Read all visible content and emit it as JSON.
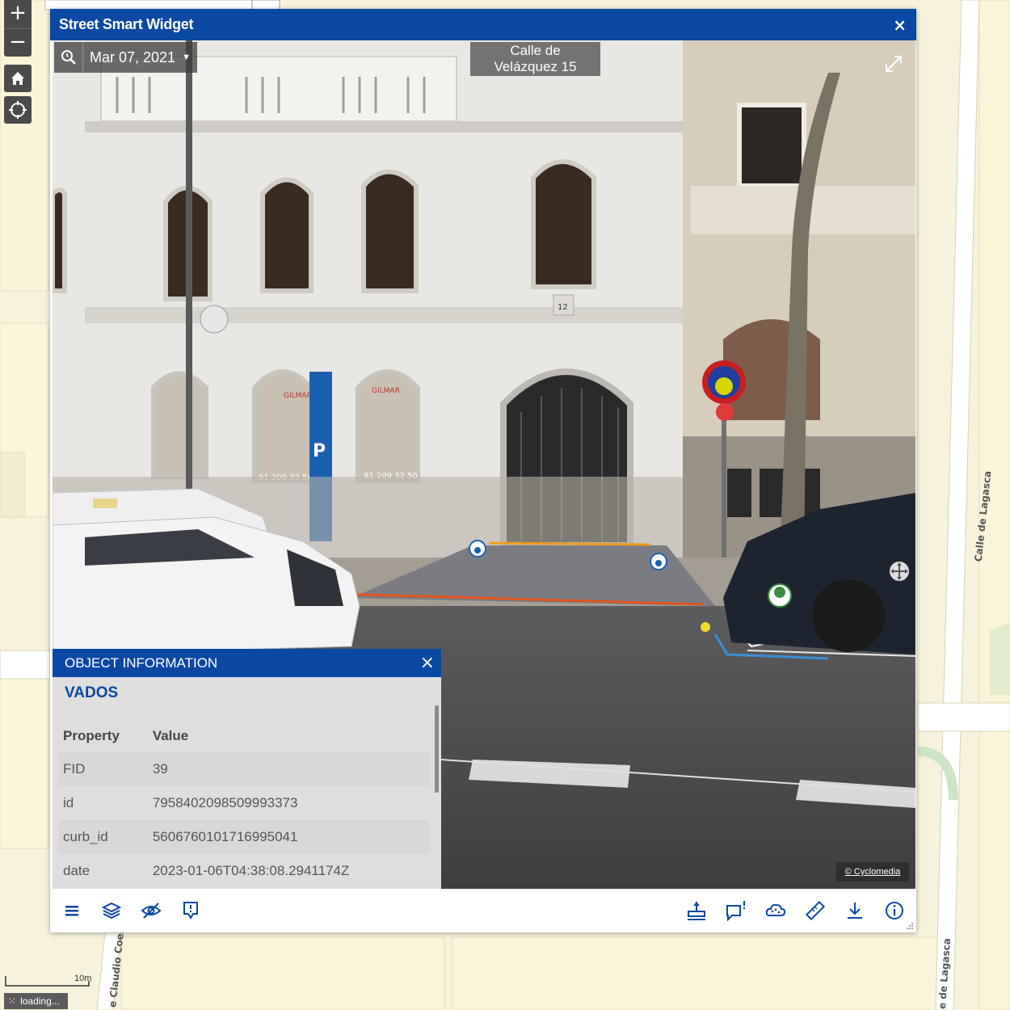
{
  "map": {
    "streets": {
      "lagasca_upper": "Calle de Lagasca",
      "lagasca_lower": "e de Lagasca",
      "coello": "e Claudio Coel"
    },
    "zoom_in": "+",
    "zoom_out": "−",
    "scale_label": "10m",
    "loading_label": "loading..."
  },
  "widget": {
    "title": "Street Smart Widget",
    "close_glyph": "×",
    "accent_color": "#0a48a3"
  },
  "viewer": {
    "date": "Mar 07, 2021",
    "address_line1": "Calle de",
    "address_line2": "Velázquez 15",
    "copyright": "© Cyclomedia"
  },
  "object_info": {
    "header": "OBJECT INFORMATION",
    "close_glyph": "×",
    "layer_name": "VADOS",
    "columns": [
      "Property",
      "Value"
    ],
    "rows": [
      {
        "property": "FID",
        "value": "39"
      },
      {
        "property": "id",
        "value": "7958402098509993373"
      },
      {
        "property": "curb_id",
        "value": "5606760101716995041"
      },
      {
        "property": "date",
        "value": "2023-01-06T04:38:08.2941174Z"
      }
    ]
  },
  "toolbar": {
    "left_tools": [
      "menu-icon",
      "layers-icon",
      "visibility-off-icon",
      "annotation-marker-icon"
    ],
    "right_tools": [
      "elevation-measure-icon",
      "report-issue-icon",
      "point-cloud-icon",
      "ruler-icon",
      "download-icon",
      "info-icon"
    ]
  }
}
